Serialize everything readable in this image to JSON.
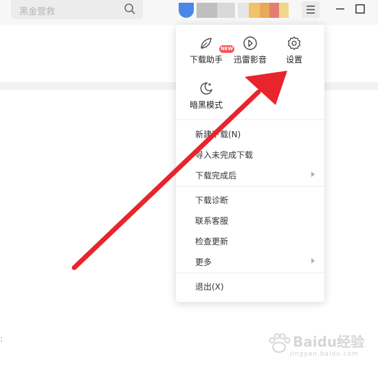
{
  "search": {
    "placeholder": "黑金营救"
  },
  "dropdown": {
    "quick_actions": [
      {
        "label": "下载助手",
        "icon": "broom-icon",
        "badge": "NEW"
      },
      {
        "label": "迅雷影音",
        "icon": "play-circle-icon"
      },
      {
        "label": "设置",
        "icon": "gear-icon"
      },
      {
        "label": "暗黑模式",
        "icon": "moon-icon"
      }
    ],
    "items": [
      {
        "label": "新建下载(N)"
      },
      {
        "label": "导入未完成下载"
      },
      {
        "label": "下载完成后",
        "submenu": true
      },
      {
        "label": "下载诊断"
      },
      {
        "label": "联系客服"
      },
      {
        "label": "检查更新"
      },
      {
        "label": "更多",
        "submenu": true
      },
      {
        "label": "退出(X)"
      }
    ]
  },
  "annotation": {
    "color": "#e8242c",
    "points_to": "设置"
  },
  "watermark": {
    "brand": "Baidu经验",
    "sub": "jingyan.baidu.com"
  }
}
